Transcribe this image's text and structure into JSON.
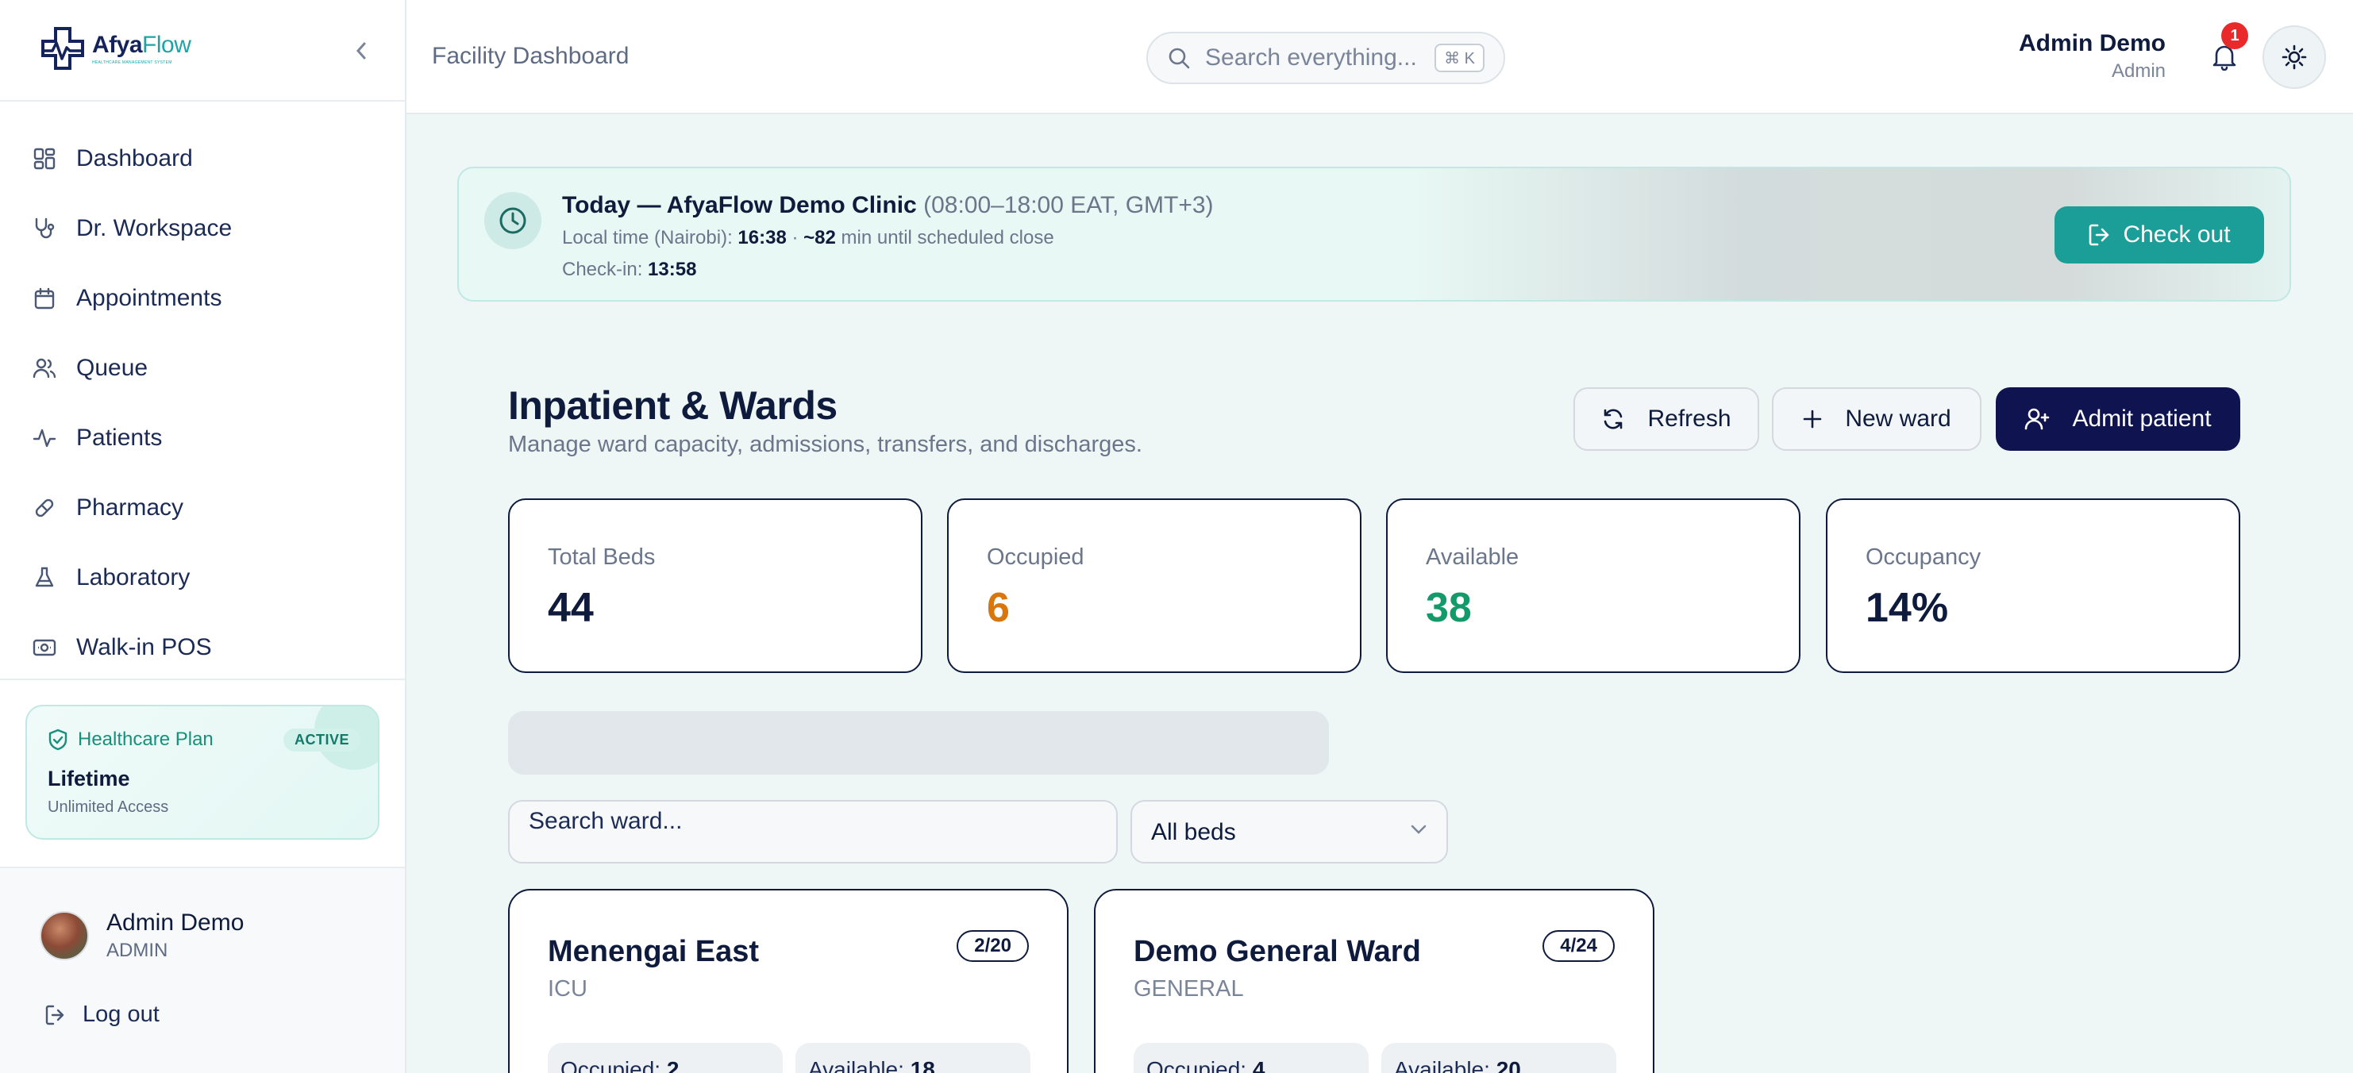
{
  "brand": {
    "name_a": "Afya",
    "name_b": "Flow",
    "tagline": "HEALTHCARE MANAGEMENT SYSTEM"
  },
  "sidebar": {
    "items": [
      {
        "label": "Dashboard",
        "icon": "dashboard-icon"
      },
      {
        "label": "Dr. Workspace",
        "icon": "stethoscope-icon"
      },
      {
        "label": "Appointments",
        "icon": "calendar-icon"
      },
      {
        "label": "Queue",
        "icon": "users-icon"
      },
      {
        "label": "Patients",
        "icon": "activity-icon"
      },
      {
        "label": "Pharmacy",
        "icon": "pill-icon"
      },
      {
        "label": "Laboratory",
        "icon": "flask-icon"
      },
      {
        "label": "Walk-in POS",
        "icon": "cash-icon"
      }
    ],
    "plan": {
      "label": "Healthcare Plan",
      "badge": "ACTIVE",
      "title": "Lifetime",
      "subtitle": "Unlimited Access"
    },
    "user": {
      "name": "Admin Demo",
      "role": "ADMIN"
    },
    "logout": "Log out"
  },
  "topbar": {
    "title": "Facility Dashboard",
    "search_placeholder": "Search everything...",
    "shortcut": "⌘ K",
    "user_name": "Admin Demo",
    "user_role": "Admin",
    "notification_count": "1"
  },
  "banner": {
    "prefix": "Today — ",
    "clinic": "AfyaFlow Demo Clinic",
    "hours": "(08:00–18:00 EAT, GMT+3)",
    "local_label": "Local time (Nairobi): ",
    "local_time": "16:38",
    "sep": " · ",
    "remaining": "~82",
    "remaining_suffix": " min until scheduled close",
    "checkin_label": "Check-in: ",
    "checkin_time": "13:58",
    "checkout_label": "Check out"
  },
  "section": {
    "title": "Inpatient & Wards",
    "subtitle": "Manage ward capacity, admissions, transfers, and discharges.",
    "refresh": "Refresh",
    "new_ward": "New ward",
    "admit": "Admit patient"
  },
  "stats": [
    {
      "label": "Total Beds",
      "value": "44",
      "color": "#0f1b3d"
    },
    {
      "label": "Occupied",
      "value": "6",
      "color": "#d9770f"
    },
    {
      "label": "Available",
      "value": "38",
      "color": "#149a6a"
    },
    {
      "label": "Occupancy",
      "value": "14%",
      "color": "#0f1b3d"
    }
  ],
  "filters": {
    "search_placeholder": "Search ward...",
    "bed_filter": "All beds"
  },
  "wards": [
    {
      "name": "Menengai East",
      "type": "ICU",
      "capacity": "2/20",
      "occupied_label": "Occupied: ",
      "occupied": "2",
      "available_label": "Available: ",
      "available": "18"
    },
    {
      "name": "Demo General Ward",
      "type": "GENERAL",
      "capacity": "4/24",
      "occupied_label": "Occupied: ",
      "occupied": "4",
      "available_label": "Available: ",
      "available": "20"
    }
  ]
}
